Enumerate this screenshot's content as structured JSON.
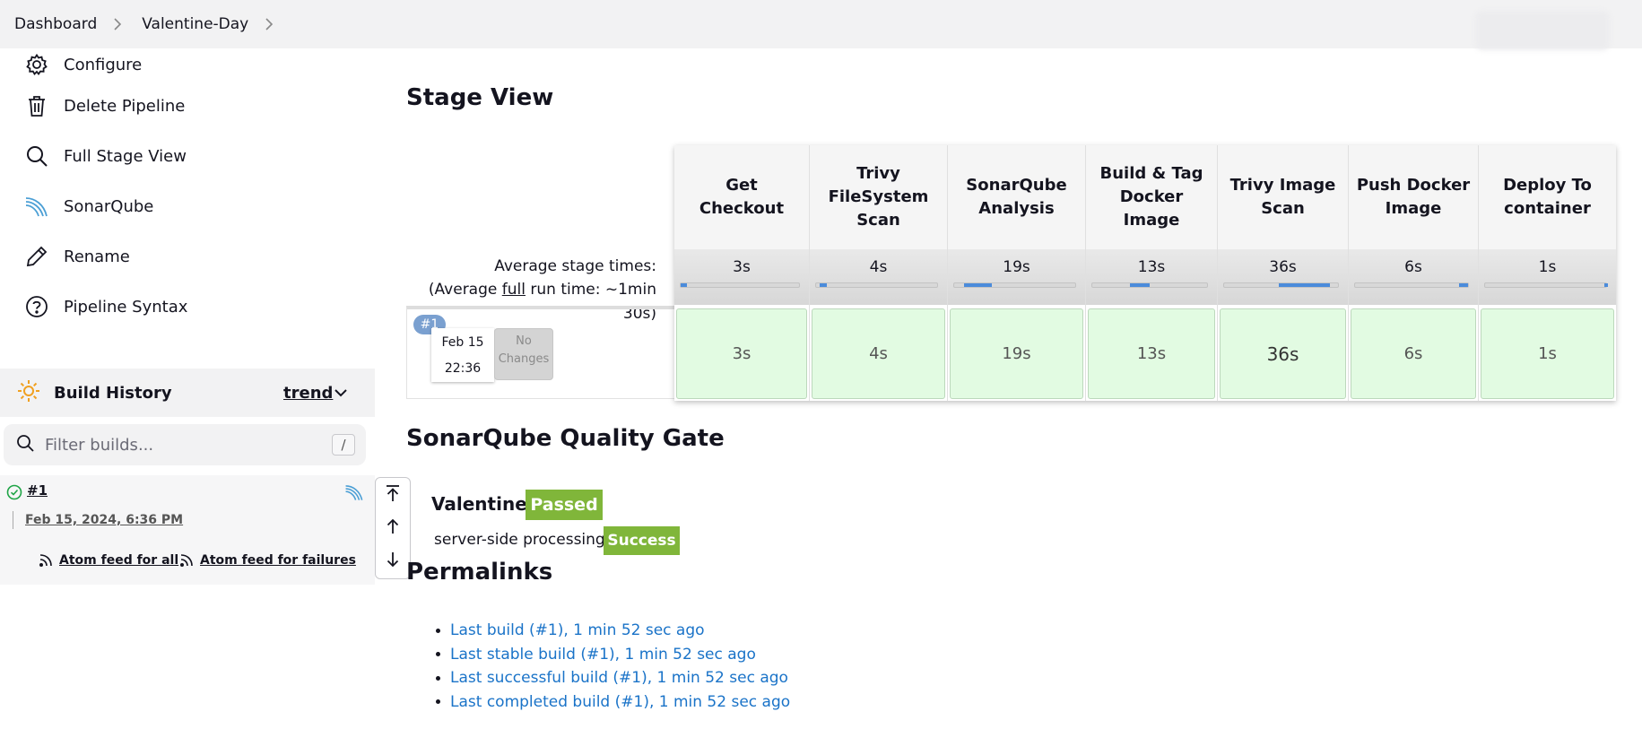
{
  "breadcrumb": {
    "items": [
      "Dashboard",
      "Valentine-Day"
    ]
  },
  "sidebar": {
    "items": [
      {
        "label": "Configure",
        "icon": "gear-icon"
      },
      {
        "label": "Delete Pipeline",
        "icon": "trash-icon"
      },
      {
        "label": "Full Stage View",
        "icon": "search-icon"
      },
      {
        "label": "SonarQube",
        "icon": "sonarqube-icon"
      },
      {
        "label": "Rename",
        "icon": "pencil-icon"
      },
      {
        "label": "Pipeline Syntax",
        "icon": "help-icon"
      }
    ]
  },
  "build_history": {
    "title": "Build History",
    "trend_label": "trend",
    "filter_placeholder": "Filter builds...",
    "filter_shortcut": "/",
    "builds": [
      {
        "number": "#1",
        "date": "Feb 15, 2024, 6:36 PM",
        "status": "success"
      }
    ],
    "atom_all": "Atom feed for all",
    "atom_failures": "Atom feed for failures"
  },
  "stage_view": {
    "title": "Stage View",
    "avg_label": "Average stage times:",
    "avg_run_prefix": "(Average ",
    "avg_run_full": "full",
    "avg_run_suffix": " run time: ~1min",
    "avg_run_suffix2": "30s)",
    "run": {
      "badge": "#1",
      "date": "Feb 15",
      "time": "22:36",
      "changes_line1": "No",
      "changes_line2": "Changes"
    },
    "stages": [
      {
        "name": "Get Checkout",
        "avg": "3s",
        "cell": "3s",
        "bar_start": 0.0,
        "bar_frac": 0.05
      },
      {
        "name": "Trivy FileSystem Scan",
        "avg": "4s",
        "cell": "4s",
        "bar_start": 0.03,
        "bar_frac": 0.06
      },
      {
        "name": "SonarQube Analysis",
        "avg": "19s",
        "cell": "19s",
        "bar_start": 0.08,
        "bar_frac": 0.23
      },
      {
        "name": "Build & Tag Docker Image",
        "avg": "13s",
        "cell": "13s",
        "bar_start": 0.33,
        "bar_frac": 0.17
      },
      {
        "name": "Trivy Image Scan",
        "avg": "36s",
        "cell": "36s",
        "bar_start": 0.48,
        "bar_frac": 0.45
      },
      {
        "name": "Push Docker Image",
        "avg": "6s",
        "cell": "6s",
        "bar_start": 0.92,
        "bar_frac": 0.08
      },
      {
        "name": "Deploy To container",
        "avg": "1s",
        "cell": "1s",
        "bar_start": 0.985,
        "bar_frac": 0.015
      }
    ]
  },
  "quality_gate": {
    "title": "SonarQube Quality Gate",
    "project": "Valentine",
    "status": "Passed",
    "processing_label": "server-side processing:",
    "processing_status": "Success",
    "badge_color": "#80b63a"
  },
  "permalinks": {
    "title": "Permalinks",
    "links": [
      "Last build (#1), 1 min 52 sec ago",
      "Last stable build (#1), 1 min 52 sec ago",
      "Last successful build (#1), 1 min 52 sec ago",
      "Last completed build (#1), 1 min 52 sec ago"
    ]
  },
  "colors": {
    "link": "#1a73c8",
    "success_cell": "#e2fbe2",
    "accent_bar": "#4b8bdb"
  }
}
